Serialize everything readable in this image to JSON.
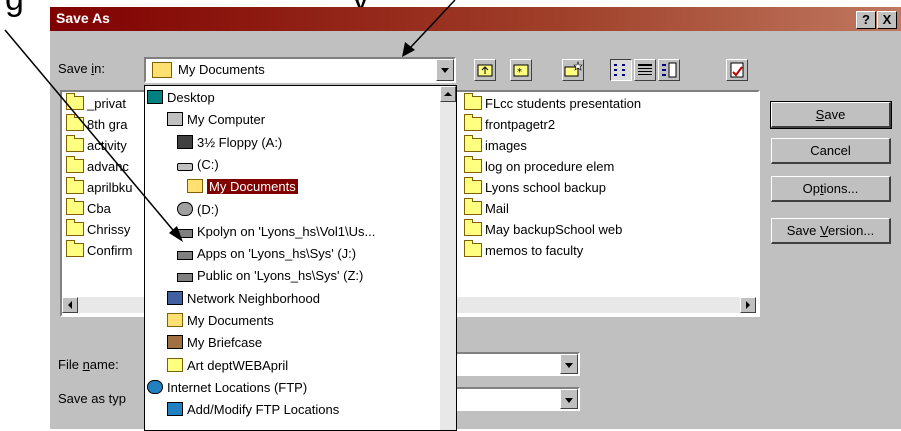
{
  "caption": "g",
  "caption2": "y",
  "window": {
    "title": "Save As",
    "help_label": "?",
    "close_label": "X"
  },
  "save_in": {
    "label_prefix": "Save ",
    "label_accel": "i",
    "label_suffix": "n:",
    "value": "My Documents"
  },
  "dropdown_items": [
    {
      "label": "Desktop",
      "icon": "desktop-icon"
    },
    {
      "label": "My Computer",
      "icon": "computer-icon"
    },
    {
      "label": "3½ Floppy (A:)",
      "icon": "floppy-icon"
    },
    {
      "label": "(C:)",
      "icon": "drive-icon"
    },
    {
      "label": "My Documents",
      "icon": "my-documents-icon",
      "selected": true
    },
    {
      "label": "(D:)",
      "icon": "cd-drive-icon"
    },
    {
      "label": "Kpolyn on 'Lyons_hs\\Vol1\\Us...",
      "icon": "network-drive-icon"
    },
    {
      "label": "Apps on 'Lyons_hs\\Sys' (J:)",
      "icon": "network-drive-icon"
    },
    {
      "label": "Public on 'Lyons_hs\\Sys' (Z:)",
      "icon": "network-drive-icon"
    },
    {
      "label": "Network Neighborhood",
      "icon": "network-neighborhood-icon"
    },
    {
      "label": "My Documents",
      "icon": "my-documents-icon"
    },
    {
      "label": "My Briefcase",
      "icon": "briefcase-icon"
    },
    {
      "label": "Art deptWEBApril",
      "icon": "folder-icon"
    },
    {
      "label": "Internet Locations (FTP)",
      "icon": "globe-icon"
    },
    {
      "label": "Add/Modify FTP Locations",
      "icon": "ftp-icon"
    }
  ],
  "left_files": [
    "_privat",
    "8th gra",
    "activity",
    "advanc",
    "aprilbku",
    "Cba",
    "Chrissy",
    "Confirm"
  ],
  "right_files": [
    "FLcc students presentation",
    "frontpagetr2",
    "images",
    "log on procedure elem",
    "Lyons school backup",
    "Mail",
    "May backupSchool web",
    "memos to faculty"
  ],
  "file_name": {
    "label_prefix": "File ",
    "label_accel": "n",
    "label_suffix": "ame:",
    "value": ""
  },
  "save_as_type": {
    "label": "Save as typ",
    "value": ""
  },
  "buttons": {
    "save_accel": "S",
    "save_rest": "ave",
    "cancel": "Cancel",
    "options_prefix": "Op",
    "options_accel": "t",
    "options_suffix": "ions...",
    "save_version_prefix": "Save ",
    "save_version_accel": "V",
    "save_version_suffix": "ersion..."
  },
  "colors": {
    "title_start": "#800000",
    "selection": "#800000",
    "folder": "#ffff80"
  }
}
